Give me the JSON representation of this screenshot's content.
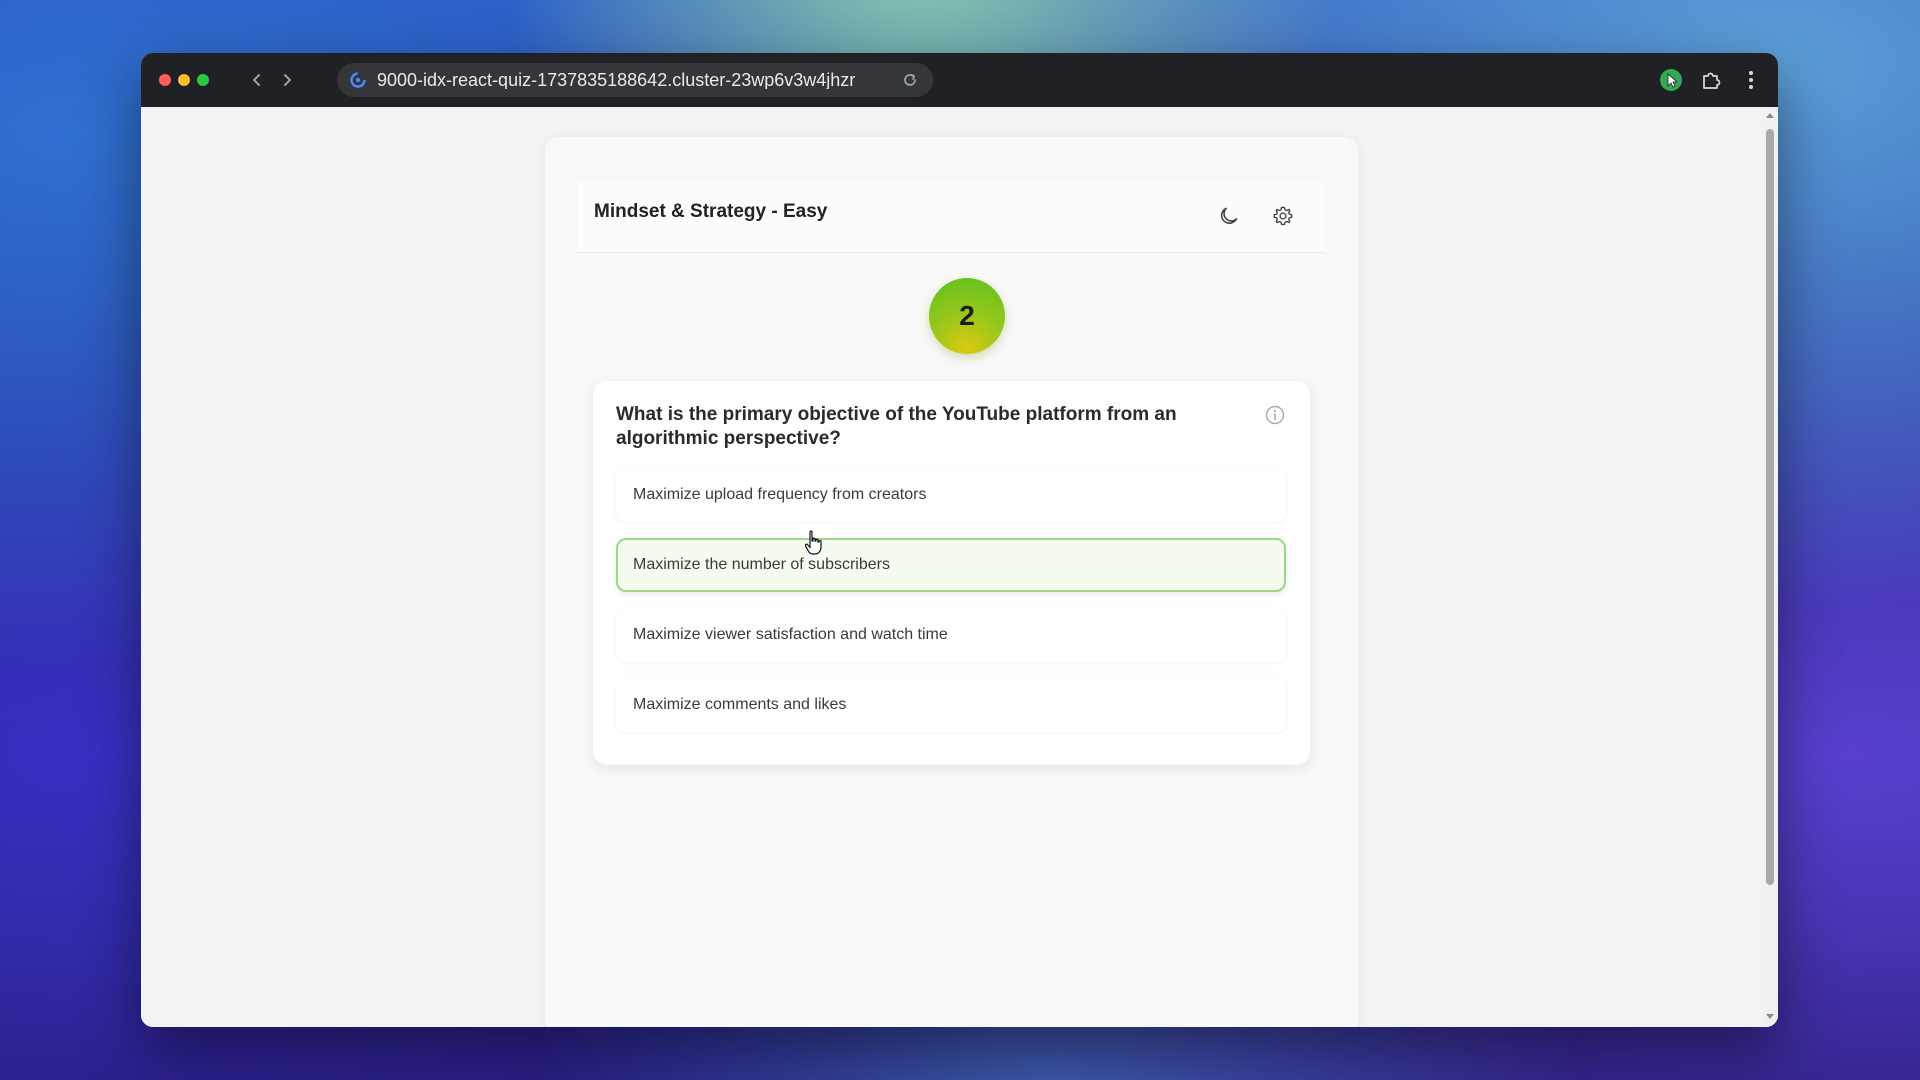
{
  "browser": {
    "url": "9000-idx-react-quiz-1737835188642.cluster-23wp6v3w4jhzr"
  },
  "quiz": {
    "title": "Mindset & Strategy - Easy",
    "question_number": "2",
    "question": "What is the primary objective of the YouTube platform from an algorithmic perspective?",
    "options": [
      {
        "label": "Maximize upload frequency from creators"
      },
      {
        "label": "Maximize the number of subscribers"
      },
      {
        "label": "Maximize viewer satisfaction and watch time"
      },
      {
        "label": "Maximize comments and likes"
      }
    ],
    "hovered_option_index": 1
  },
  "icons": {
    "back": "chevron-left-icon",
    "forward": "chevron-right-icon",
    "reload": "reload-icon",
    "theme": "moon-icon",
    "settings": "gear-icon",
    "info": "info-icon",
    "extensions": "puzzle-icon",
    "menu": "kebab-menu-icon"
  },
  "colors": {
    "titlebar": "#202124",
    "selected_border": "#9fd68c",
    "badge_gradient": [
      "#5bbf20",
      "#e0c810"
    ]
  }
}
